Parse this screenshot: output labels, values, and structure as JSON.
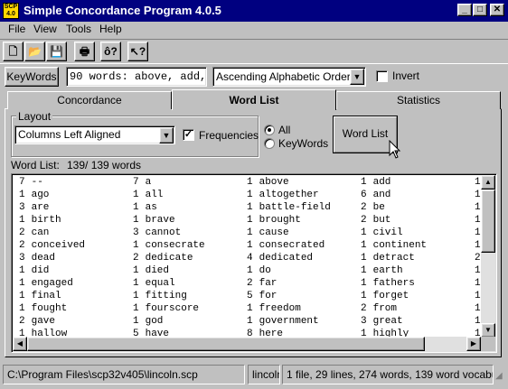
{
  "window": {
    "title": "Simple Concordance Program 4.0.5",
    "icon_text": "SCP 4.0",
    "title_bar_color": "#000080",
    "controls": [
      "_",
      "□",
      "✕"
    ]
  },
  "menu": [
    "File",
    "View",
    "Tools",
    "Help"
  ],
  "toolbar": {
    "buttons": [
      {
        "name": "new-file-icon",
        "glyph": "🗋"
      },
      {
        "name": "open-folder-icon",
        "glyph": "📂"
      },
      {
        "name": "save-icon",
        "glyph": "💾"
      },
      {
        "name": "print-icon",
        "glyph": "🖶"
      },
      {
        "name": "about-icon",
        "glyph": "ô?"
      },
      {
        "name": "context-help-icon",
        "glyph": "↖?"
      }
    ]
  },
  "keywords": {
    "button_label": "KeyWords",
    "field_value": "90 words: above, add,",
    "order_value": "Ascending Alphabetic Order",
    "invert_label": "Invert",
    "invert_checked": false
  },
  "tabs": [
    {
      "label": "Concordance",
      "active": false
    },
    {
      "label": "Word List",
      "active": true
    },
    {
      "label": "Statistics",
      "active": false
    }
  ],
  "layout": {
    "group_label": "Layout",
    "select_value": "Columns Left Aligned",
    "frequencies_label": "Frequencies",
    "frequencies_checked": true,
    "radio_all": "All",
    "radio_keywords": "KeyWords",
    "selected_radio": "All",
    "wordlist_button": "Word List"
  },
  "wordlist": {
    "label": "Word List:",
    "count": "139/ 139 words",
    "rows": [
      [
        [
          "7",
          "--"
        ],
        [
          "7",
          "a"
        ],
        [
          "1",
          "above"
        ],
        [
          "1",
          "add"
        ],
        [
          "1",
          ""
        ]
      ],
      [
        [
          "1",
          "ago"
        ],
        [
          "1",
          "all"
        ],
        [
          "1",
          "altogether"
        ],
        [
          "6",
          "and"
        ],
        [
          "1",
          ""
        ]
      ],
      [
        [
          "3",
          "are"
        ],
        [
          "1",
          "as"
        ],
        [
          "1",
          "battle-field"
        ],
        [
          "2",
          "be"
        ],
        [
          "1",
          ""
        ]
      ],
      [
        [
          "1",
          "birth"
        ],
        [
          "1",
          "brave"
        ],
        [
          "1",
          "brought"
        ],
        [
          "2",
          "but"
        ],
        [
          "1",
          ""
        ]
      ],
      [
        [
          "2",
          "can"
        ],
        [
          "3",
          "cannot"
        ],
        [
          "1",
          "cause"
        ],
        [
          "1",
          "civil"
        ],
        [
          "1",
          ""
        ]
      ],
      [
        [
          "2",
          "conceived"
        ],
        [
          "1",
          "consecrate"
        ],
        [
          "1",
          "consecrated"
        ],
        [
          "1",
          "continent"
        ],
        [
          "1",
          ""
        ]
      ],
      [
        [
          "3",
          "dead"
        ],
        [
          "2",
          "dedicate"
        ],
        [
          "4",
          "dedicated"
        ],
        [
          "1",
          "detract"
        ],
        [
          "2",
          ""
        ]
      ],
      [
        [
          "1",
          "did"
        ],
        [
          "1",
          "died"
        ],
        [
          "1",
          "do"
        ],
        [
          "1",
          "earth"
        ],
        [
          "1",
          ""
        ]
      ],
      [
        [
          "1",
          "engaged"
        ],
        [
          "1",
          "equal"
        ],
        [
          "2",
          "far"
        ],
        [
          "1",
          "fathers"
        ],
        [
          "1",
          ""
        ]
      ],
      [
        [
          "1",
          "final"
        ],
        [
          "1",
          "fitting"
        ],
        [
          "5",
          "for"
        ],
        [
          "1",
          "forget"
        ],
        [
          "1",
          ""
        ]
      ],
      [
        [
          "1",
          "fought"
        ],
        [
          "1",
          "fourscore"
        ],
        [
          "1",
          "freedom"
        ],
        [
          "2",
          "from"
        ],
        [
          "1",
          ""
        ]
      ],
      [
        [
          "2",
          "gave"
        ],
        [
          "1",
          "god"
        ],
        [
          "1",
          "government"
        ],
        [
          "3",
          "great"
        ],
        [
          "1",
          ""
        ]
      ],
      [
        [
          "1",
          "hallow"
        ],
        [
          "5",
          "have"
        ],
        [
          "8",
          "here"
        ],
        [
          "1",
          "highly"
        ],
        [
          "1",
          ""
        ]
      ]
    ]
  },
  "status": {
    "path": "C:\\Program Files\\scp32v405\\lincoln.scp",
    "file": "lincoln",
    "summary": "1 file, 29 lines, 274 words, 139 word vocabulary"
  }
}
